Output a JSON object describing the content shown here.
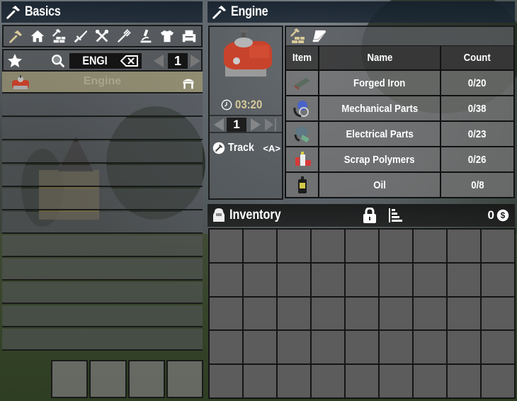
{
  "basics_panel": {
    "title": "Basics",
    "categories": [
      {
        "name": "basics",
        "icon": "hammer-icon",
        "active": true
      },
      {
        "name": "building",
        "icon": "house-icon",
        "active": false
      },
      {
        "name": "workstations",
        "icon": "hammer-bricks-icon",
        "active": false
      },
      {
        "name": "weapons",
        "icon": "sword-icon",
        "active": false
      },
      {
        "name": "tools",
        "icon": "tools-icon",
        "active": false
      },
      {
        "name": "food",
        "icon": "fork-icon",
        "active": false
      },
      {
        "name": "science",
        "icon": "microscope-icon",
        "active": false
      },
      {
        "name": "clothing",
        "icon": "shirt-icon",
        "active": false
      },
      {
        "name": "decor",
        "icon": "armchair-icon",
        "active": false
      }
    ],
    "search": {
      "value": "ENGI",
      "placeholder": ""
    },
    "page": "1",
    "recipes": [
      {
        "name": "Engine",
        "selected": true,
        "station_icon": "workbench-icon"
      }
    ],
    "empty_rows": 11,
    "toolbelt_slots": 4
  },
  "engine_panel": {
    "title": "Engine",
    "craft_time": "03:20",
    "quantity": "1",
    "track_label": "Track",
    "track_key": "<A>",
    "ingredients_header": {
      "item": "Item",
      "name": "Name",
      "count": "Count"
    },
    "ingredients": [
      {
        "name": "Forged Iron",
        "count": "0/20",
        "icon": "forged-iron-icon"
      },
      {
        "name": "Mechanical Parts",
        "count": "0/38",
        "icon": "mechanical-parts-icon"
      },
      {
        "name": "Electrical Parts",
        "count": "0/23",
        "icon": "electrical-parts-icon"
      },
      {
        "name": "Scrap Polymers",
        "count": "0/26",
        "icon": "scrap-polymers-icon"
      },
      {
        "name": "Oil",
        "count": "0/8",
        "icon": "oil-icon"
      }
    ]
  },
  "inventory_panel": {
    "title": "Inventory",
    "currency": "0",
    "columns": 9,
    "rows": 5
  },
  "colors": {
    "accent_tan": "#d8c99a",
    "selected_row": "#8c876e"
  }
}
